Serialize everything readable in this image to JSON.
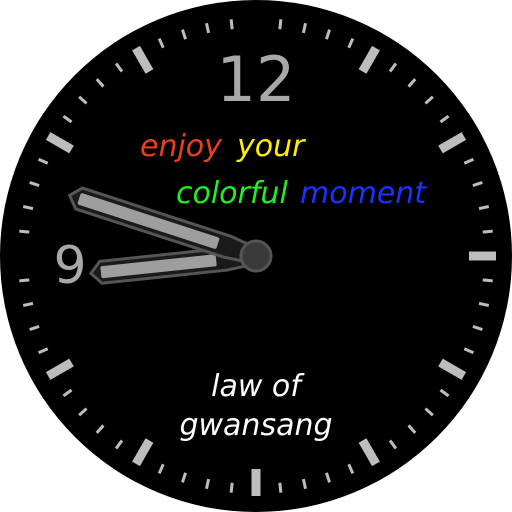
{
  "watch_face": {
    "numerals": {
      "twelve": "12",
      "nine": "9"
    },
    "tagline": {
      "word1": "enjoy",
      "word2": "your",
      "word3": "colorful",
      "word4": "moment"
    },
    "brand": {
      "line1": "law of",
      "line2": "gwansang"
    },
    "time": {
      "hour": 8,
      "minute": 48
    },
    "colors": {
      "face": "#000000",
      "ticks": "#bdbdbd",
      "numerals": "#a8a8a8",
      "hands": "#9e9e9e",
      "hand_outline": "#555555",
      "word1": "#e8401c",
      "word2": "#ffee00",
      "word3": "#22ee22",
      "word4": "#1a32ff",
      "brand_text": "#ffffff"
    }
  }
}
